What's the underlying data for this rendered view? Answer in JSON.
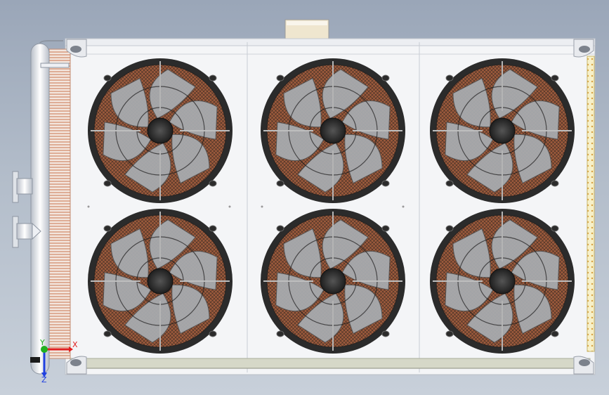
{
  "viewport": {
    "model": "condenser-unit-top-view",
    "fan_count": 6,
    "fan_grid": {
      "rows": 2,
      "cols": 3
    },
    "colors": {
      "background_top": "#9aa6b8",
      "background_bottom": "#c8d0da",
      "frame": "#f4f5f7",
      "frame_edge": "#b9bec6",
      "fin_tube": "#c9744f",
      "fan_ring": "#2b2b2b",
      "fan_blade": "#a0a4a8",
      "coil": "#9c5a3c",
      "rail": "#d6d8c8"
    },
    "icons": [
      "bracket-icon",
      "pipe-icon",
      "fan-icon",
      "axis-triad-icon"
    ]
  },
  "axis_triad": {
    "x_label": "X",
    "y_label": "Y",
    "z_label": "Z",
    "x_color": "#e02020",
    "y_color": "#20b020",
    "z_color": "#2040e0"
  }
}
